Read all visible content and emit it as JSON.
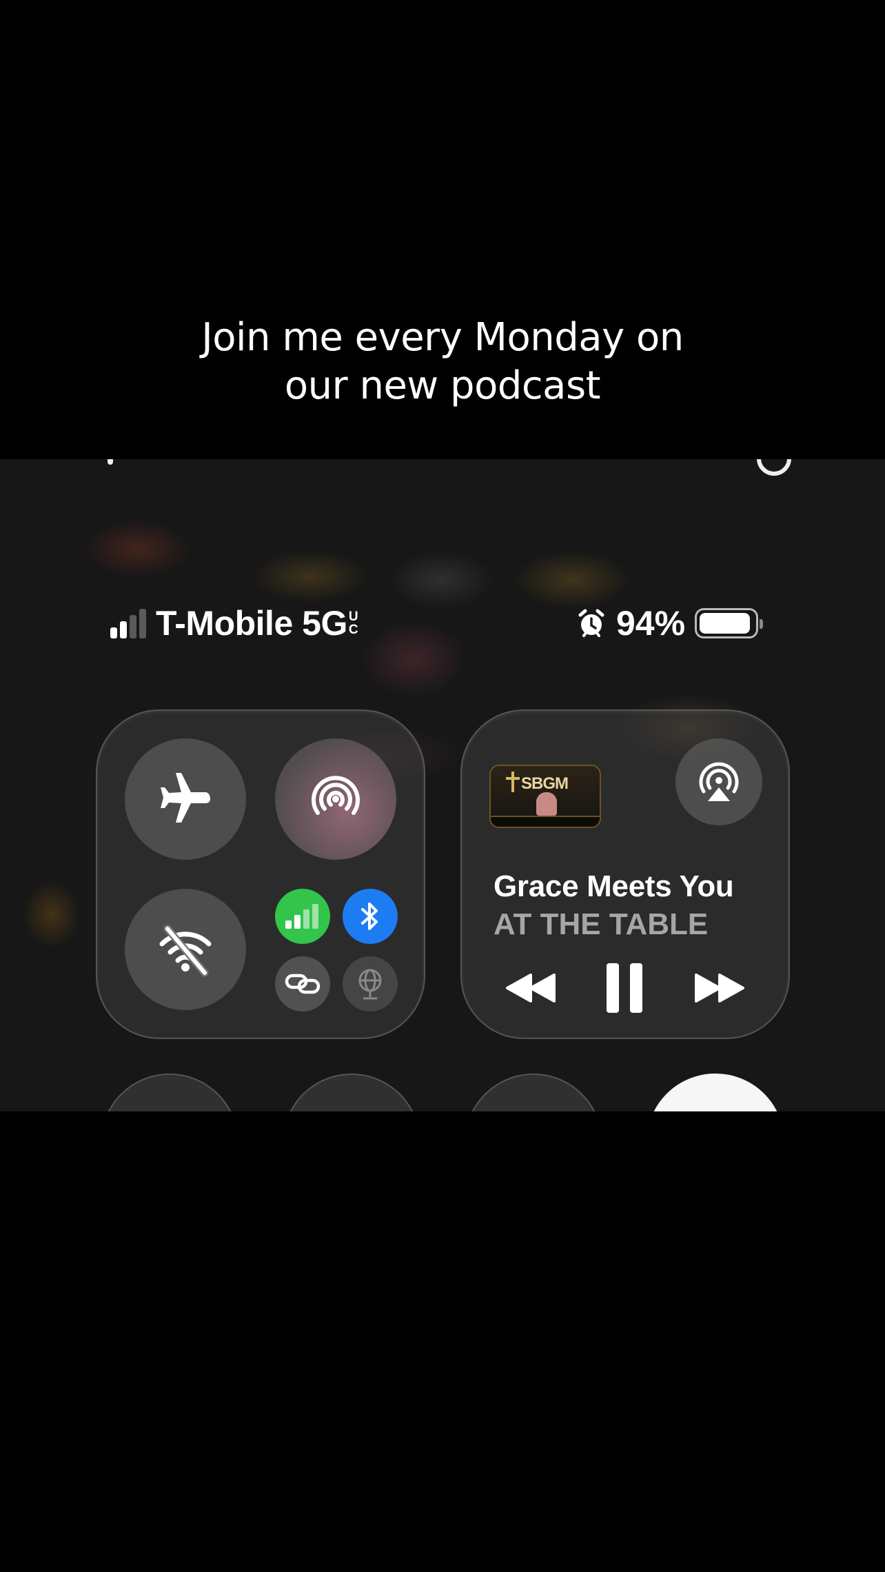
{
  "caption": {
    "line1": "Join me every Monday on",
    "line2": "our new podcast"
  },
  "status_bar": {
    "carrier": "T-Mobile 5G",
    "network_suffix_top": "U",
    "network_suffix_bottom": "C",
    "signal_bars_active": 2,
    "signal_bars_total": 4,
    "battery_percent": "94%",
    "battery_level": 0.94,
    "icons": [
      "signal-icon",
      "alarm-icon",
      "battery-icon"
    ]
  },
  "connectivity": {
    "buttons": [
      {
        "name": "airplane-mode",
        "icon": "airplane-icon",
        "state": "off"
      },
      {
        "name": "airdrop",
        "icon": "airdrop-icon",
        "state": "on"
      },
      {
        "name": "wifi",
        "icon": "wifi-off-icon",
        "state": "off"
      },
      {
        "name": "cellular-data",
        "icon": "cellular-icon",
        "state": "on",
        "color": "#33c44b"
      },
      {
        "name": "bluetooth",
        "icon": "bluetooth-icon",
        "state": "on",
        "color": "#1e7cf2"
      },
      {
        "name": "personal-hotspot",
        "icon": "link-icon",
        "state": "off"
      },
      {
        "name": "vpn",
        "icon": "globe-icon",
        "state": "disabled"
      }
    ]
  },
  "now_playing": {
    "artwork_text": "SBGM",
    "title": "Grace Meets You",
    "artist": "AT THE TABLE",
    "state": "playing",
    "controls": [
      "rewind-icon",
      "pause-icon",
      "fast-forward-icon",
      "airplay-icon"
    ]
  },
  "colors": {
    "accent_green": "#33c44b",
    "accent_blue": "#1e7cf2",
    "secondary_text": "#a6a6a6"
  }
}
